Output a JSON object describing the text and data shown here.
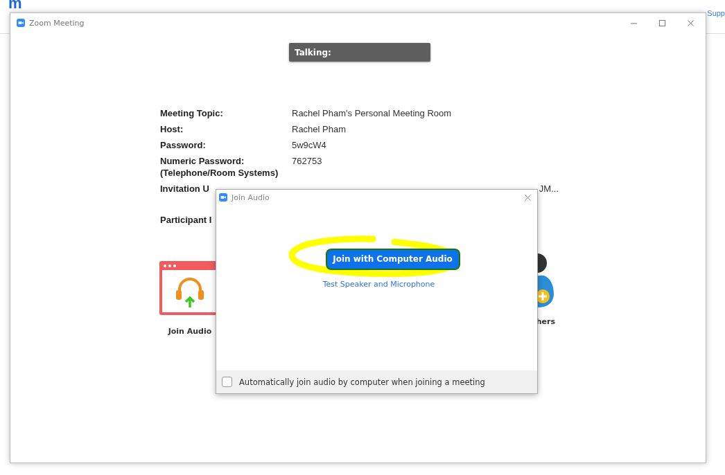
{
  "browser": {
    "logo": "m",
    "link": "Supp"
  },
  "window": {
    "title": "Zoom Meeting"
  },
  "talking": {
    "label": "Talking:"
  },
  "meeting_info": [
    {
      "label": "Meeting Topic:",
      "value": "Rachel Pham's Personal Meeting Room"
    },
    {
      "label": "Host:",
      "value": "Rachel Pham"
    },
    {
      "label": "Password:",
      "value": "5w9cW4"
    },
    {
      "label": "Numeric Password:\n(Telephone/Room Systems)",
      "value": "762753"
    },
    {
      "label": "Invitation U",
      "value": "JM..."
    },
    {
      "label": "Participant I"
    }
  ],
  "actions": [
    {
      "kind": "audio",
      "label": "Join Audio"
    },
    {
      "kind": "invite",
      "label": "hers"
    }
  ],
  "dialog": {
    "title": "Join Audio",
    "primary_button": "Join with Computer Audio",
    "link": "Test Speaker and Microphone",
    "auto_join": {
      "label": "Automatically join audio by computer when joining a meeting",
      "checked": false
    }
  }
}
